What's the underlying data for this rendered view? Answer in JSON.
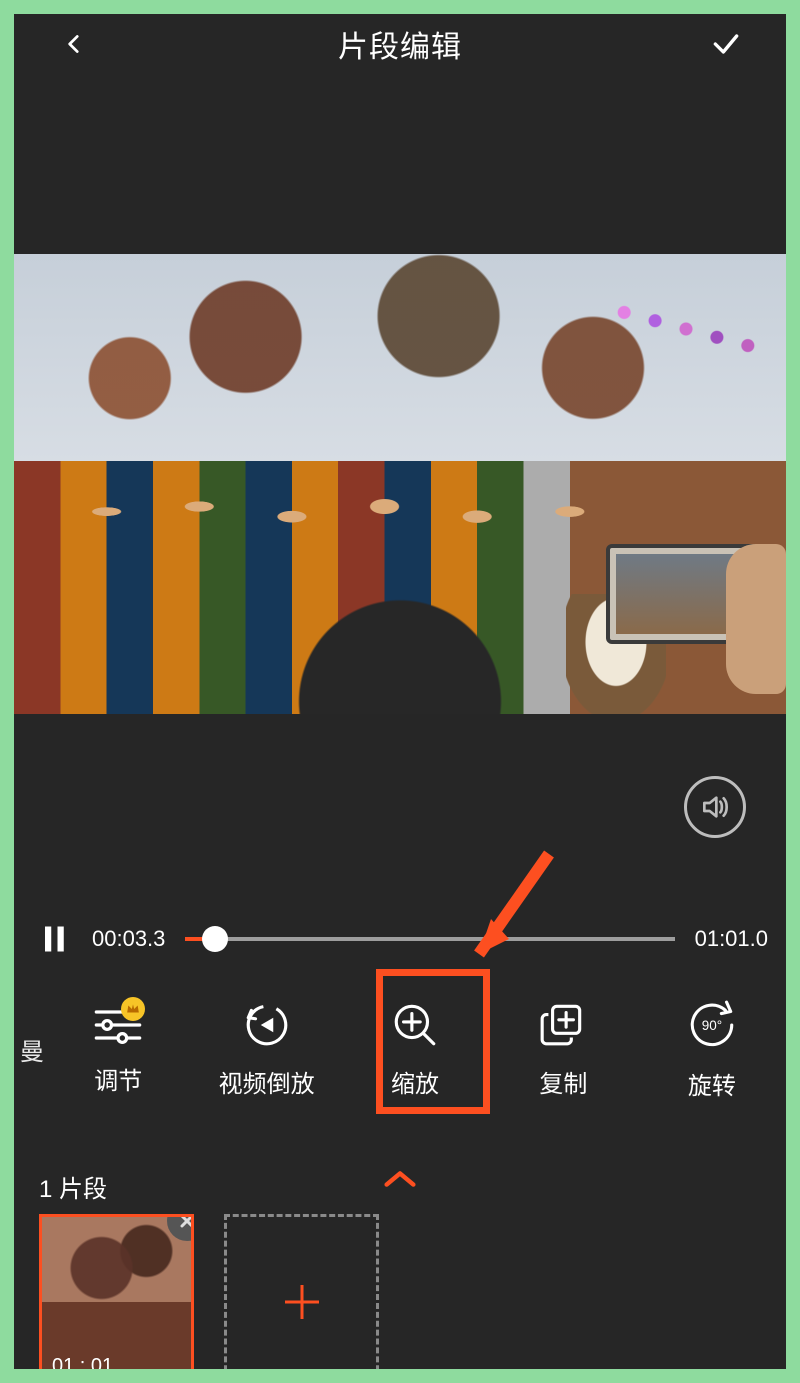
{
  "header": {
    "title": "片段编辑"
  },
  "playback": {
    "current_time": "00:03.3",
    "total_time": "01:01.0",
    "progress_percent": 6,
    "is_playing": true
  },
  "tools": {
    "partial_left_label": "曼",
    "items": [
      {
        "id": "adjust",
        "label": "调节",
        "icon": "sliders-icon",
        "has_crown_badge": true
      },
      {
        "id": "reverse",
        "label": "视频倒放",
        "icon": "reverse-icon"
      },
      {
        "id": "zoom",
        "label": "缩放",
        "icon": "zoom-in-icon",
        "highlighted": true
      },
      {
        "id": "copy",
        "label": "复制",
        "icon": "copy-plus-icon"
      },
      {
        "id": "rotate",
        "label": "旋转",
        "icon": "rotate-90-icon",
        "angle_label": "90°"
      }
    ]
  },
  "segments": {
    "count_label": "1 片段",
    "clips": [
      {
        "duration": "01 : 01"
      }
    ]
  },
  "annotation": {
    "arrow_color": "#fd4f20",
    "highlight_color": "#fd4f20",
    "target_tool": "zoom"
  },
  "colors": {
    "accent": "#fd4f20",
    "frame": "#8edb9e",
    "bg": "#262626"
  }
}
